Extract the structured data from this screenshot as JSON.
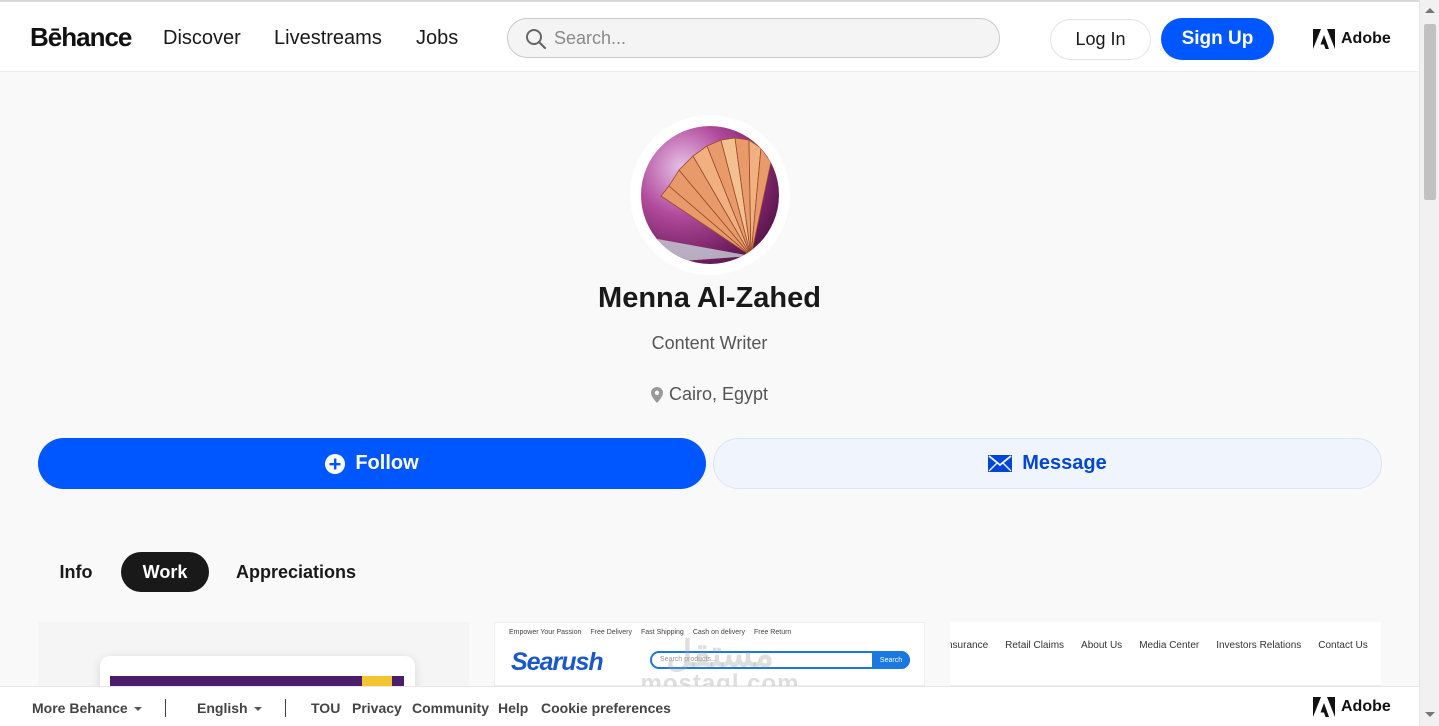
{
  "header": {
    "logo": "Bēhance",
    "nav": [
      "Discover",
      "Livestreams",
      "Jobs"
    ],
    "search_placeholder": "Search...",
    "login_label": "Log In",
    "signup_label": "Sign Up",
    "adobe_label": "Adobe"
  },
  "profile": {
    "name": "Menna Al-Zahed",
    "title": "Content Writer",
    "location": "Cairo, Egypt",
    "follow_label": "Follow",
    "message_label": "Message"
  },
  "tabs": [
    {
      "label": "Info",
      "active": false
    },
    {
      "label": "Work",
      "active": true
    },
    {
      "label": "Appreciations",
      "active": false
    }
  ],
  "projects": {
    "card2": {
      "top_links": [
        "Empower Your Passion",
        "Free Delivery",
        "Fast Shipping",
        "Cash on delivery",
        "Free Return"
      ],
      "logo": "Searush",
      "search_placeholder": "Search products...",
      "search_button": "Search"
    },
    "card3": {
      "nav": [
        "nsurance",
        "Retail Claims",
        "About Us",
        "Media Center",
        "Investors Relations",
        "Contact Us"
      ]
    }
  },
  "footer": {
    "more_behance": "More Behance",
    "language": "English",
    "links": [
      "TOU",
      "Privacy",
      "Community",
      "Help",
      "Cookie preferences"
    ],
    "adobe_label": "Adobe"
  },
  "watermark": {
    "arabic": "مستقل",
    "latin": "mostaql.com"
  },
  "colors": {
    "accent": "#0057ff",
    "message_bg": "#f0f4fc",
    "tab_active_bg": "#191919"
  }
}
